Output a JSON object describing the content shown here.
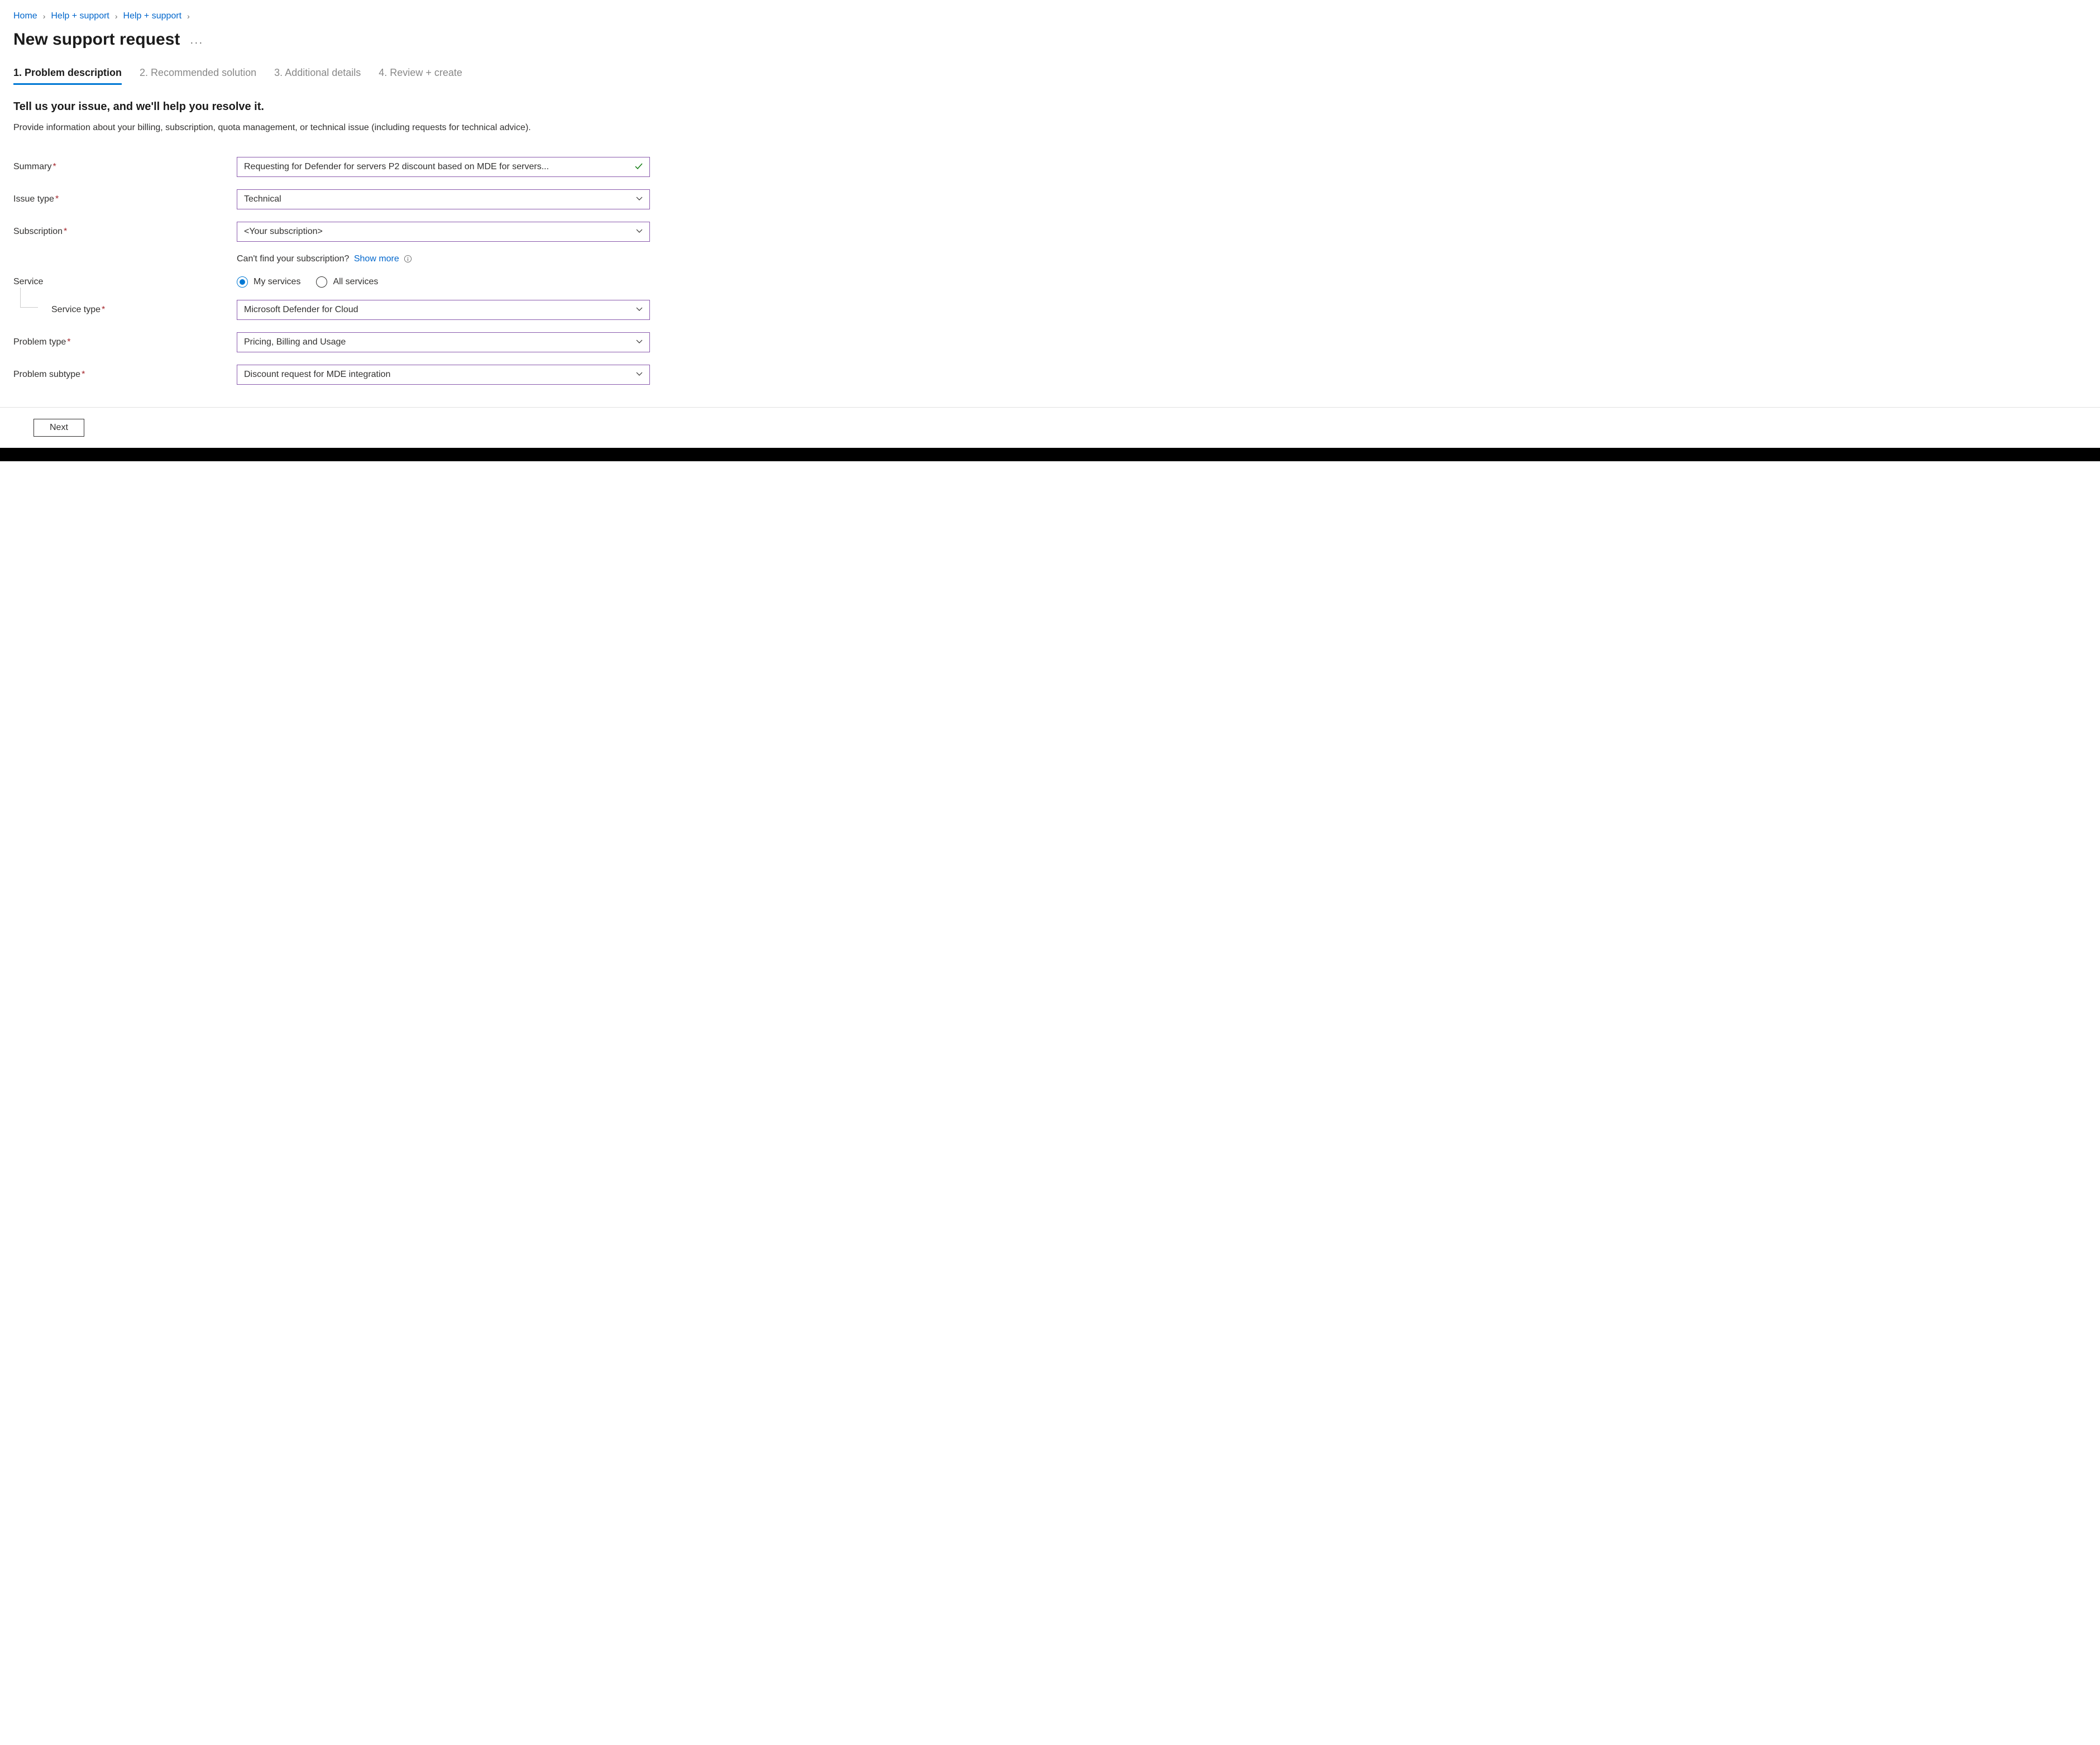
{
  "breadcrumb": {
    "home": "Home",
    "help1": "Help + support",
    "help2": "Help + support"
  },
  "page_title": "New support request",
  "tabs": {
    "t1": "1. Problem description",
    "t2": "2. Recommended solution",
    "t3": "3. Additional details",
    "t4": "4. Review + create"
  },
  "section": {
    "heading": "Tell us your issue, and we'll help you resolve it.",
    "description": "Provide information about your billing, subscription, quota management, or technical issue (including requests for technical advice)."
  },
  "labels": {
    "summary": "Summary",
    "issue_type": "Issue type",
    "subscription": "Subscription",
    "service": "Service",
    "service_type": "Service type",
    "problem_type": "Problem type",
    "problem_subtype": "Problem subtype"
  },
  "values": {
    "summary": "Requesting for Defender for servers P2 discount based on MDE for servers...",
    "issue_type": "Technical",
    "subscription": "<Your subscription>",
    "service_type": "Microsoft Defender for Cloud",
    "problem_type": "Pricing, Billing and Usage",
    "problem_subtype": "Discount request for MDE integration"
  },
  "helper": {
    "text": "Can't find your subscription?",
    "link": "Show more"
  },
  "radio": {
    "my_services": "My services",
    "all_services": "All services"
  },
  "buttons": {
    "next": "Next"
  }
}
